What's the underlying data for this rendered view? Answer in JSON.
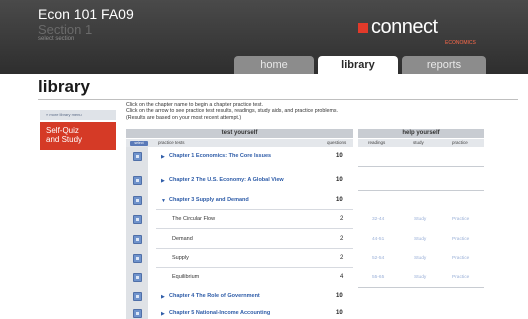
{
  "header": {
    "course_title": "Econ 101 FA09",
    "section_title": "Section 1",
    "select_section": "select section",
    "logo_text": "connect",
    "logo_sub": "ECONOMICS"
  },
  "tabs": [
    {
      "label": "home"
    },
    {
      "label": "library"
    },
    {
      "label": "reports"
    }
  ],
  "page_title": "library",
  "sidebar": {
    "more_link": "» more library menu",
    "selfquiz_line1": "Self-Quiz",
    "selfquiz_line2": "and Study"
  },
  "instructions": [
    "Click on the chapter name to begin a chapter practice test.",
    "Click on the arrow to see practice test results, readings, study aids, and practice problems.",
    "(Results are based on your most recent attempt.)"
  ],
  "panels": {
    "test_header": "test yourself",
    "help_header": "help yourself",
    "select_button": "select",
    "col_practice_tests": "practice tests",
    "col_questions": "questions",
    "col_readings": "readings",
    "col_study": "study",
    "col_practice": "practice"
  },
  "rows": {
    "ch1": {
      "arrow": "▶",
      "title": "Chapter 1 Economics: The Core Issues",
      "questions": "10"
    },
    "ch2": {
      "arrow": "▶",
      "title": "Chapter 2 The U.S. Economy: A Global View",
      "questions": "10"
    },
    "ch3": {
      "arrow": "▼",
      "title": "Chapter 3 Supply and Demand",
      "questions": "10"
    },
    "sub1": {
      "title": "The Circular Flow",
      "questions": "2",
      "reading": "32-44",
      "study": "Study",
      "practice": "Practice"
    },
    "sub2": {
      "title": "Demand",
      "questions": "2",
      "reading": "44-51",
      "study": "Study",
      "practice": "Practice"
    },
    "sub3": {
      "title": "Supply",
      "questions": "2",
      "reading": "52-54",
      "study": "Study",
      "practice": "Practice"
    },
    "sub4": {
      "title": "Equilibrium",
      "questions": "4",
      "reading": "55-65",
      "study": "Study",
      "practice": "Practice"
    },
    "ch4": {
      "arrow": "▶",
      "title": "Chapter 4 The Role of Government",
      "questions": "10"
    },
    "ch5": {
      "arrow": "▶",
      "title": "Chapter 5 National-Income Accounting",
      "questions": "10"
    }
  },
  "colors": {
    "accent_red": "#d53a26",
    "link_blue": "#2e5ca8",
    "header_dark": "#3a3a3a"
  }
}
